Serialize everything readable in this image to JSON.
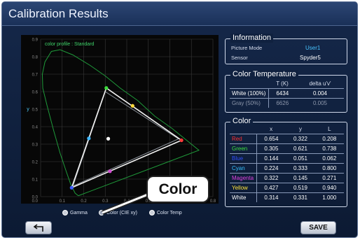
{
  "window": {
    "title": "Calibration Results"
  },
  "chart": {
    "profile_label": "color profile : Standard",
    "y_ticks": [
      "0.9",
      "0.8",
      "0.7",
      "0.6",
      "0.5",
      "0.4",
      "0.3",
      "0.2",
      "0.1",
      "0.0"
    ],
    "x_ticks": [
      "0.1",
      "0.2",
      "0.3",
      "0.4",
      "0.5",
      "0.6",
      "0.7",
      "0.8"
    ],
    "y_label": "y"
  },
  "chart_data": {
    "type": "scatter",
    "title": "color profile : Standard",
    "xlabel": "",
    "ylabel": "y",
    "xlim": [
      0.0,
      0.8
    ],
    "ylim": [
      0.0,
      0.9
    ],
    "grid": true,
    "measured_points": [
      {
        "name": "Red",
        "x": 0.654,
        "y": 0.322,
        "color": "#ff3b3b"
      },
      {
        "name": "Green",
        "x": 0.305,
        "y": 0.621,
        "color": "#3ddc3d"
      },
      {
        "name": "Blue",
        "x": 0.144,
        "y": 0.051,
        "color": "#3b5bff"
      },
      {
        "name": "Cyan",
        "x": 0.224,
        "y": 0.333,
        "color": "#3fb7ff"
      },
      {
        "name": "Magenta",
        "x": 0.322,
        "y": 0.145,
        "color": "#d24bd2"
      },
      {
        "name": "Yellow",
        "x": 0.427,
        "y": 0.519,
        "color": "#ffd93b"
      },
      {
        "name": "White",
        "x": 0.314,
        "y": 0.331,
        "color": "#ffffff"
      }
    ],
    "reference_triangle": [
      [
        0.64,
        0.33
      ],
      [
        0.3,
        0.6
      ],
      [
        0.15,
        0.06
      ]
    ]
  },
  "view_options": {
    "gamma": "Gamma",
    "cie": "Color (CIE xy)",
    "temp": "Color Temp",
    "selected": "cie"
  },
  "callout": {
    "text": "Color"
  },
  "information": {
    "heading": "Information",
    "picture_mode_label": "Picture Mode",
    "picture_mode_value": "User1",
    "sensor_label": "Sensor",
    "sensor_value": "Spyder5"
  },
  "color_temperature": {
    "heading": "Color Temperature",
    "col_t": "T (K)",
    "col_delta": "delta u'v'",
    "rows": [
      {
        "label": "White (100%)",
        "t": "6434",
        "delta": "0.004"
      },
      {
        "label": "Gray (50%)",
        "t": "6626",
        "delta": "0.005"
      }
    ]
  },
  "color_table": {
    "heading": "Color",
    "col_x": "x",
    "col_y": "y",
    "col_l": "L",
    "rows": [
      {
        "label": "Red",
        "x": "0.654",
        "y": "0.322",
        "l": "0.208",
        "color": "#ff3030"
      },
      {
        "label": "Green",
        "x": "0.305",
        "y": "0.621",
        "l": "0.738",
        "color": "#3ee03e"
      },
      {
        "label": "Blue",
        "x": "0.144",
        "y": "0.051",
        "l": "0.062",
        "color": "#3050ff"
      },
      {
        "label": "Cyan",
        "x": "0.224",
        "y": "0.333",
        "l": "0.800",
        "color": "#35c0ff"
      },
      {
        "label": "Magenta",
        "x": "0.322",
        "y": "0.145",
        "l": "0.271",
        "color": "#e040e0"
      },
      {
        "label": "Yellow",
        "x": "0.427",
        "y": "0.519",
        "l": "0.940",
        "color": "#ffe23a"
      },
      {
        "label": "White",
        "x": "0.314",
        "y": "0.331",
        "l": "1.000",
        "color": "#ffffff"
      }
    ]
  },
  "buttons": {
    "save": "SAVE",
    "back_icon": "back-arrow-icon"
  }
}
